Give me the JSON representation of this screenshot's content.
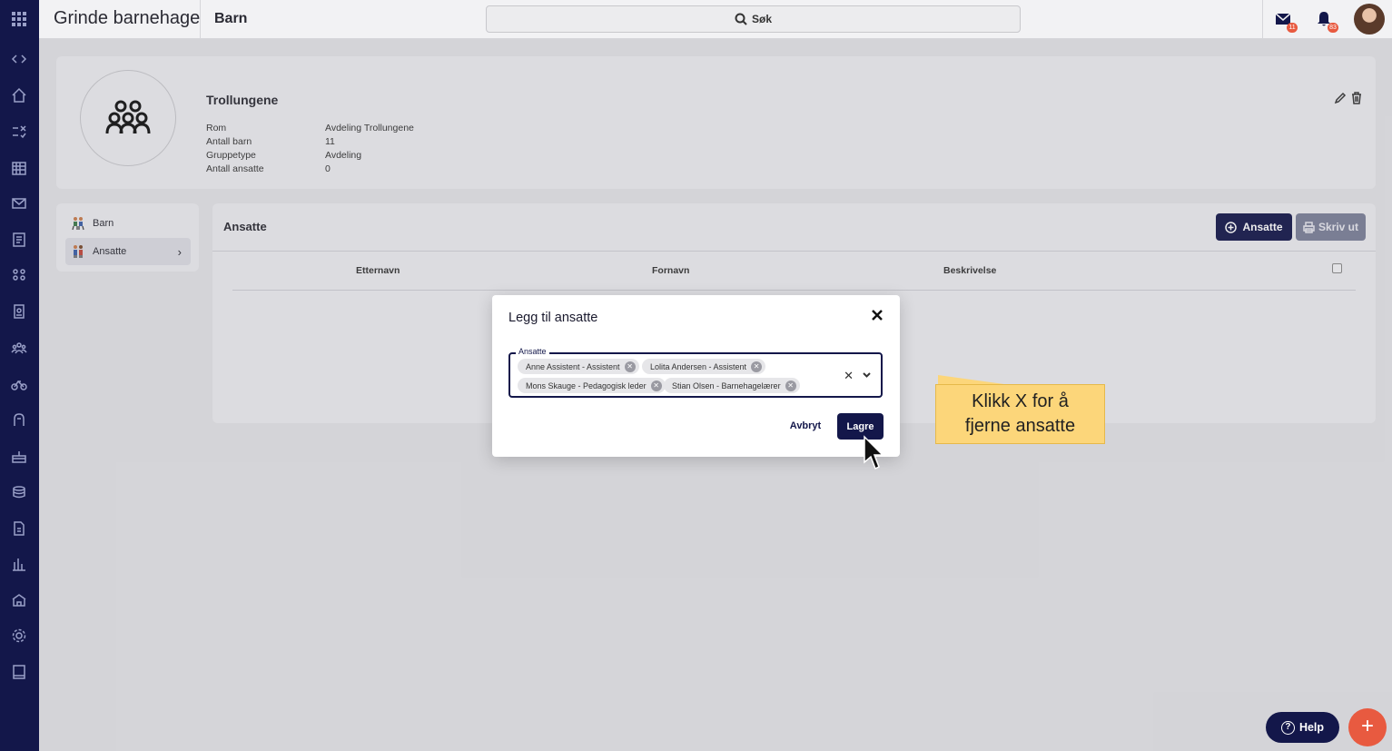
{
  "topbar": {
    "brand": "Grinde barnehage",
    "section": "Barn",
    "search_label": "Søk",
    "mail_badge": "11",
    "notification_badge": "83"
  },
  "group": {
    "name": "Trollungene",
    "properties": [
      {
        "label": "Rom",
        "value": "Avdeling Trollungene"
      },
      {
        "label": "Antall barn",
        "value": "11"
      },
      {
        "label": "Gruppetype",
        "value": "Avdeling"
      },
      {
        "label": "Antall ansatte",
        "value": "0"
      }
    ]
  },
  "sidenav": {
    "items": [
      {
        "label": "Barn",
        "active": false
      },
      {
        "label": "Ansatte",
        "active": true
      }
    ]
  },
  "employees": {
    "title": "Ansatte",
    "add_label": "Ansatte",
    "print_label": "Skriv ut",
    "columns": [
      "Etternavn",
      "Fornavn",
      "Beskrivelse"
    ]
  },
  "modal": {
    "title": "Legg til ansatte",
    "field_label": "Ansatte",
    "chips": [
      "Anne Assistent - Assistent",
      "Lolita Andersen - Assistent",
      "Mons Skauge - Pedagogisk leder",
      "Stian Olsen - Barnehagelærer"
    ],
    "cancel_label": "Avbryt",
    "save_label": "Lagre"
  },
  "callout": {
    "line1": "Klikk X for å",
    "line2": "fjerne ansatte"
  },
  "help_label": "Help",
  "fab_label": "+",
  "colors": {
    "navy": "#13174a",
    "accent_red": "#e85a40",
    "callout_yellow": "#fcd67a"
  }
}
